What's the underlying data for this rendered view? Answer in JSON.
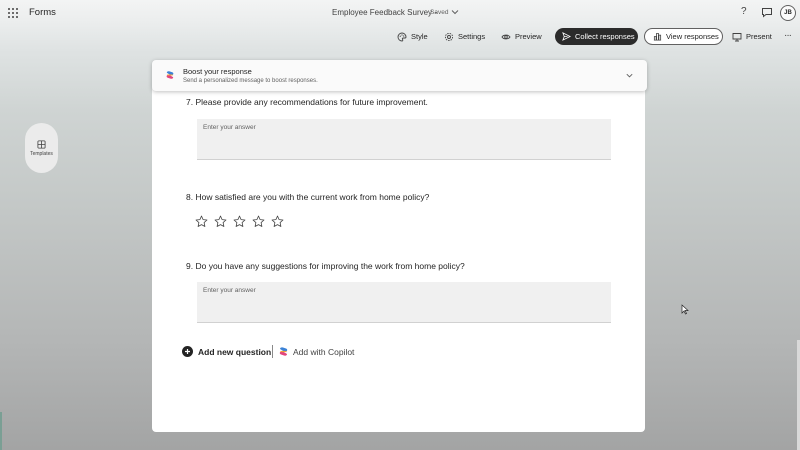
{
  "header": {
    "app_name": "Forms",
    "doc_title": "Employee Feedback Survey",
    "doc_separator": "-",
    "doc_status": "Saved",
    "help_glyph": "?",
    "avatar_initials": "JB",
    "icons": [
      "app-launcher-icon",
      "chevron-down-icon",
      "help-icon",
      "chat-icon"
    ]
  },
  "toolbar": {
    "style_label": "Style",
    "settings_label": "Settings",
    "preview_label": "Preview",
    "collect_label": "Collect responses",
    "view_label": "View responses",
    "present_label": "Present",
    "more_glyph": "···"
  },
  "sidebar": {
    "templates_label": "Templates"
  },
  "boost": {
    "title": "Boost your response",
    "subtitle": "Send a personalized message to boost responses."
  },
  "questions": [
    {
      "number": "7.",
      "text": "Please provide any recommendations for future improvement.",
      "type": "text",
      "placeholder": "Enter your answer"
    },
    {
      "number": "8.",
      "text": "How satisfied are you with the current work from home policy?",
      "type": "rating",
      "star_count": 5,
      "rating_value": 0
    },
    {
      "number": "9.",
      "text": "Do you have any suggestions for improving the work from home policy?",
      "type": "text",
      "placeholder": "Enter your answer"
    }
  ],
  "actions": {
    "add_question_label": "Add new question",
    "add_copilot_label": "Add with Copilot"
  },
  "colors": {
    "primary_button": "#2b2b2b",
    "card": "#ffffff",
    "answer_field": "#f0f0f0"
  }
}
